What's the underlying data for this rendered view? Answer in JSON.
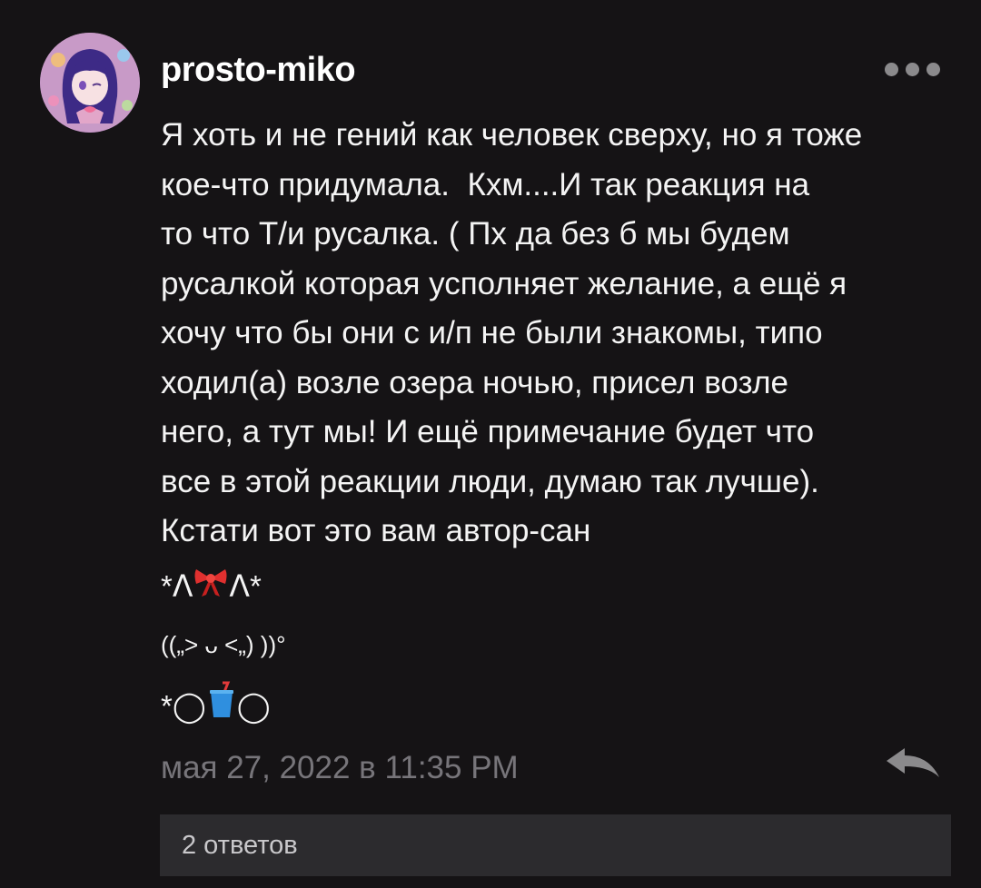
{
  "comment": {
    "username": "prosto-miko",
    "text_lines": [
      "Я хоть и не гений как человек сверху, но я тоже",
      "кое-что придумала.  Кхм....И так реакция на",
      "то что Т/и русалка. ( Пх да без б мы будем",
      "русалкой которая усполняет желание, а ещё я",
      "хочу что бы они с и/п не были знакомы, типо",
      "ходил(а) возле озера ночью, присел возле",
      "него, а тут мы! И ещё примечание будет что",
      "все в этой реакции люди, думаю так лучше).",
      "Кстати вот это вам автор-сан"
    ],
    "kaomoji": {
      "line1_left": "*ᐱ",
      "line1_right": "ᐱ*",
      "line2": "((„> ᴗ <„) ))°",
      "line3_left": "*◯",
      "line3_right": "◯"
    },
    "timestamp": "мая 27, 2022 в 11:35 PM",
    "replies_label": "2 ответов"
  },
  "icons": {
    "more": "more-horizontal-icon",
    "reply": "reply-arrow-icon",
    "bow": "ribbon-emoji",
    "cup": "cup-with-straw-emoji"
  },
  "colors": {
    "background": "#151315",
    "text": "#f4f4f4",
    "muted": "#77757a",
    "replies_bg": "#2c2b2e"
  }
}
